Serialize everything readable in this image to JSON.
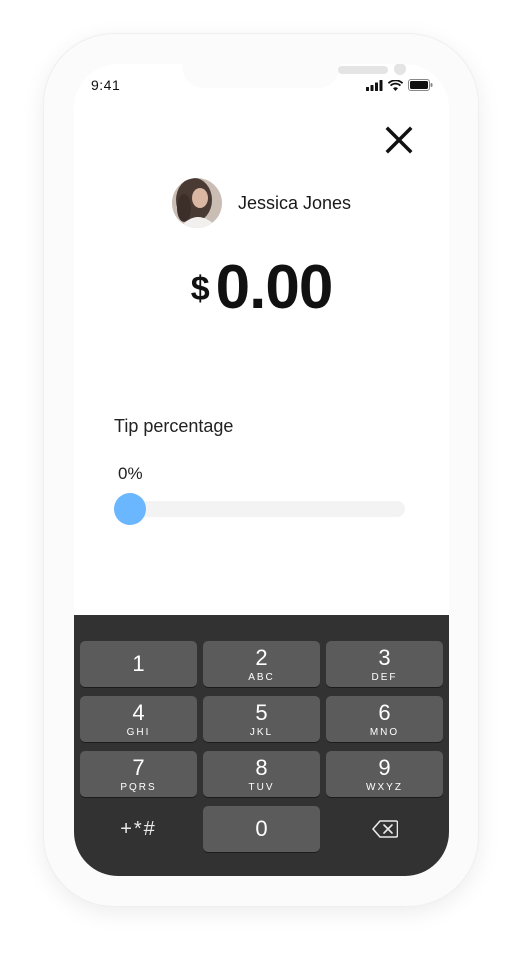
{
  "status_bar": {
    "time": "9:41"
  },
  "payment": {
    "recipient_name": "Jessica Jones",
    "currency_symbol": "$",
    "amount": "0.00"
  },
  "tip": {
    "label": "Tip percentage",
    "value_text": "0%",
    "value_percent": 0
  },
  "keypad": {
    "keys": [
      {
        "digit": "1",
        "letters": ""
      },
      {
        "digit": "2",
        "letters": "ABC"
      },
      {
        "digit": "3",
        "letters": "DEF"
      },
      {
        "digit": "4",
        "letters": "GHI"
      },
      {
        "digit": "5",
        "letters": "JKL"
      },
      {
        "digit": "6",
        "letters": "MNO"
      },
      {
        "digit": "7",
        "letters": "PQRS"
      },
      {
        "digit": "8",
        "letters": "TUV"
      },
      {
        "digit": "9",
        "letters": "WXYZ"
      }
    ],
    "symbols_label": "+*#",
    "zero": "0"
  },
  "colors": {
    "accent": "#6bb7ff",
    "keypad_bg": "#323232",
    "key_bg": "#5b5b5b"
  },
  "icons": [
    "close-icon",
    "signal-icon",
    "wifi-icon",
    "battery-icon",
    "backspace-icon"
  ]
}
